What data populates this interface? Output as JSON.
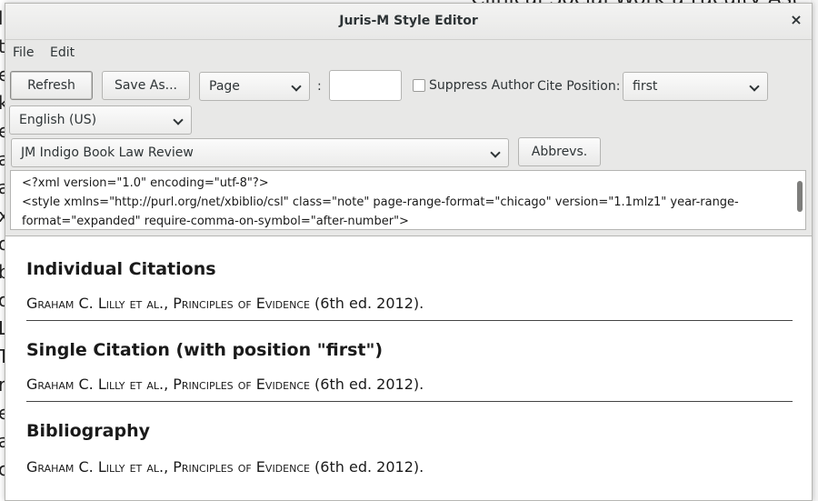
{
  "background": {
    "top_text": "Clinical Social Work a Faculty Ast",
    "left_chars": [
      "l",
      "t",
      "e",
      "k",
      "e",
      "a",
      "a",
      "x",
      "o",
      "b",
      "o",
      "L",
      "T",
      "r",
      "e",
      "a",
      "c"
    ]
  },
  "window": {
    "title": "Juris-M Style Editor",
    "close_glyph": "×"
  },
  "menubar": {
    "file_label": "File",
    "edit_label": "Edit"
  },
  "toolbar": {
    "refresh_label": "Refresh",
    "save_as_label": "Save As...",
    "locator_select": "Page",
    "colon": ":",
    "locator_value": "",
    "suppress_author_label": "Suppress Author",
    "suppress_author_checked": false,
    "cite_position_label": "Cite Position:",
    "cite_position_select": "first",
    "locale_select": "English (US)",
    "style_select": "JM Indigo Book Law Review",
    "abbrevs_label": "Abbrevs."
  },
  "editor": {
    "line1": "<?xml version=\"1.0\" encoding=\"utf-8\"?>",
    "line2": "<style xmlns=\"http://purl.org/net/xbiblio/csl\" class=\"note\" page-range-format=\"chicago\" version=\"1.1mlz1\" year-range-",
    "line3": "format=\"expanded\" require-comma-on-symbol=\"after-number\">"
  },
  "preview": {
    "sections": [
      {
        "heading": "Individual Citations",
        "author": "Graham C. Lilly et al.",
        "sep": ", ",
        "work": "Principles of Evidence",
        "tail": " (6th ed. 2012)."
      },
      {
        "heading": "Single Citation (with position \"first\")",
        "author": "Graham C. Lilly et al.",
        "sep": ", ",
        "work": "Principles of Evidence",
        "tail": " (6th ed. 2012)."
      },
      {
        "heading": "Bibliography",
        "author": "Graham C. Lilly et al.",
        "sep": ", ",
        "work": "Principles of Evidence",
        "tail": " (6th ed. 2012)."
      }
    ]
  }
}
